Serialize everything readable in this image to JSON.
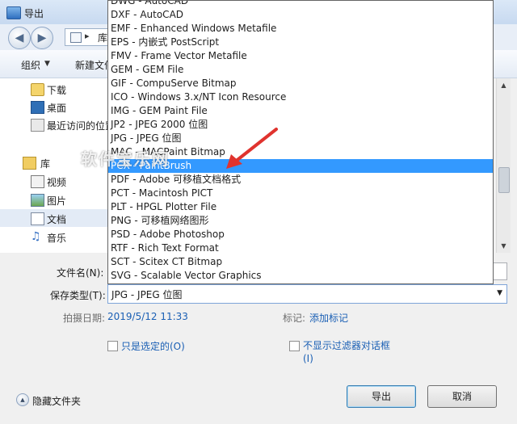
{
  "window": {
    "title": "导出"
  },
  "nav": {
    "address": "库"
  },
  "toolbar": {
    "organize": "组织",
    "new_folder": "新建文件夹"
  },
  "sidebar": {
    "items": [
      {
        "label": "下载",
        "icon": "download-folder-icon"
      },
      {
        "label": "桌面",
        "icon": "desktop-icon"
      },
      {
        "label": "最近访问的位置",
        "icon": "recent-places-icon"
      },
      {
        "label": "库",
        "icon": "library-icon"
      },
      {
        "label": "视频",
        "icon": "video-library-icon"
      },
      {
        "label": "图片",
        "icon": "picture-library-icon"
      },
      {
        "label": "文档",
        "icon": "document-library-icon"
      },
      {
        "label": "音乐",
        "icon": "music-library-icon"
      }
    ]
  },
  "dropdown": {
    "options": [
      "DWG - AutoCAD",
      "DXF - AutoCAD",
      "EMF - Enhanced Windows Metafile",
      "EPS - 内嵌式 PostScript",
      "FMV - Frame Vector Metafile",
      "GEM - GEM File",
      "GIF - CompuServe Bitmap",
      "ICO - Windows 3.x/NT Icon Resource",
      "IMG - GEM Paint File",
      "JP2 - JPEG 2000 位图",
      "JPG - JPEG 位图",
      "MAC - MACPaint Bitmap",
      "PCX - PaintBrush",
      "PDF - Adobe 可移植文档格式",
      "PCT - Macintosh PICT",
      "PLT - HPGL Plotter File",
      "PNG - 可移植网络图形",
      "PSD - Adobe Photoshop",
      "RTF - Rich Text Format",
      "SCT - Scitex CT Bitmap",
      "SVG - Scalable Vector Graphics"
    ],
    "highlighted_index": 12
  },
  "form": {
    "filename_label": "文件名(N):",
    "filename_value": "",
    "type_label": "保存类型(T):",
    "type_value": "JPG - JPEG 位图",
    "date_label": "拍摄日期:",
    "date_value": "2019/5/12 11:33",
    "tag_label": "标记:",
    "tag_value": "添加标记",
    "only_selected": "只是选定的(O)",
    "no_filter_dialog": "不显示过滤器对话框",
    "no_filter_dialog_key": "(I)"
  },
  "footer": {
    "hide_folders": "隐藏文件夹",
    "export": "导出",
    "cancel": "取消"
  },
  "watermark": "软件宝乐网",
  "colors": {
    "highlight": "#3399ff",
    "link": "#1a5fb4",
    "annotation": "#e0332e"
  }
}
